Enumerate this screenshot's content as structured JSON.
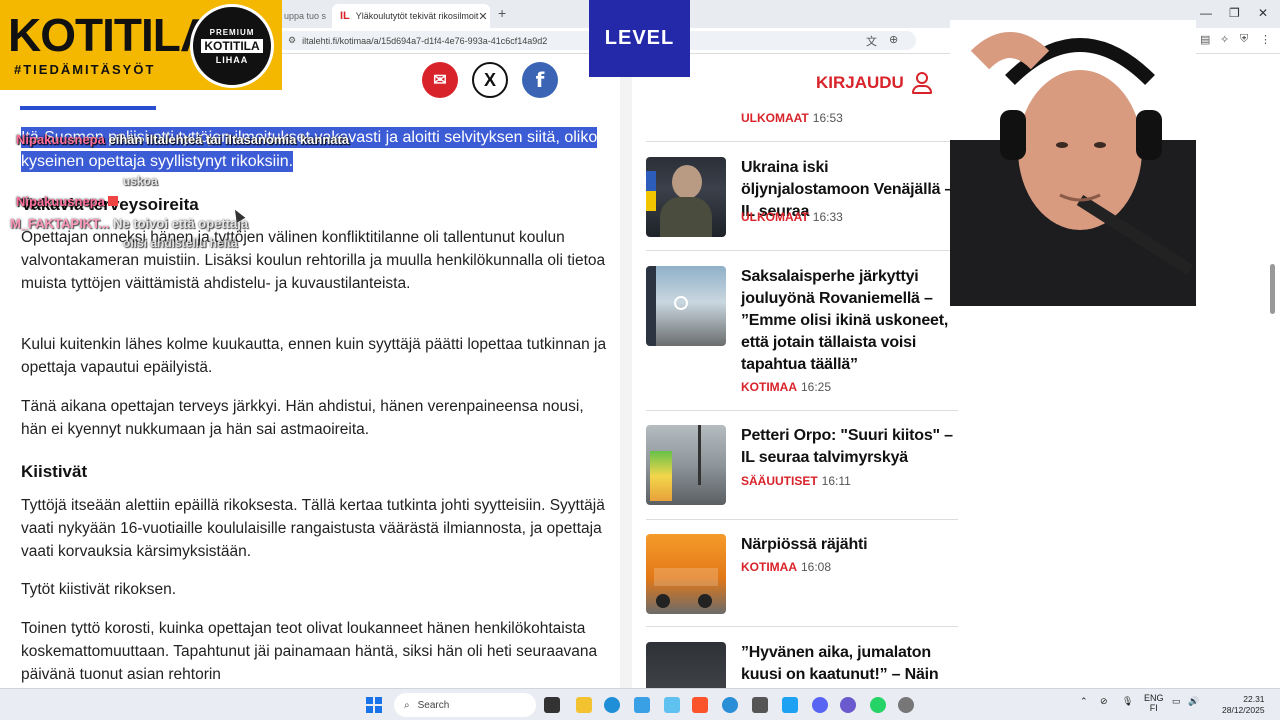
{
  "browser": {
    "inactive_tab": "uppa tuo s",
    "active_tab": "Yläkoulutytöt tekivät rikosilmoit",
    "url": "iltalehti.fi/kotimaa/a/15d694a7-d1f4-4e76-993a-41c6cf14a9d2"
  },
  "header": {
    "login_label": "KIRJAUDU"
  },
  "article": {
    "lead": "Itä-Suomen poliisi otti tyttöjen ilmoitukset vakavasti ja aloitti selvityksen siitä, oliko kyseinen opettaja syyllistynyt rikoksiin.",
    "heading1": "Vakavia terveysoireita",
    "p1": "Opettajan onneksi hänen ja tyttöjen välinen konfliktitilanne oli tallentunut koulun valvontakameran muistiin. Lisäksi koulun rehtorilla ja muulla henkilökunnalla oli tietoa muista tyttöjen väittämistä ahdistelu- ja kuvaustilanteista.",
    "p2": "Kului kuitenkin lähes kolme kuukautta, ennen kuin syyttäjä päätti lopettaa tutkinnan ja opettaja vapautui epäilyistä.",
    "p3": "Tänä aikana opettajan terveys järkkyi. Hän ahdistui, hänen verenpaineensa nousi, hän ei kyennyt nukkumaan ja hän sai astmaoireita.",
    "heading2": "Kiistivät",
    "p4": "Tyttöjä itseään alettiin epäillä rikoksesta. Tällä kertaa tutkinta johti syytteisiin. Syyttäjä vaati nykyään 16-vuotiaille koululaisille rangaistusta väärästä ilmiannosta, ja opettaja vaati korvauksia kärsimyksistään.",
    "p5": "Tytöt kiistivät rikoksen.",
    "p6": "Toinen tyttö korosti, kuinka opettajan teot olivat loukanneet hänen henkilökohtaista koskemattomuuttaan. Tapahtunut jäi painamaan häntä, siksi hän oli heti seuraavana päivänä tuonut asian rehtorin"
  },
  "news": [
    {
      "title": "",
      "category": "ULKOMAAT",
      "time": "16:53"
    },
    {
      "title": "Ukraina iski öljynjalostamoon Venäjällä – IL seuraa",
      "category": "ULKOMAAT",
      "time": "16:33"
    },
    {
      "title": "Saksalaisperhe järkyttyi jouluyönä Rovaniemellä – ”Emme olisi ikinä uskoneet, että jotain tällaista voisi tapahtua täällä”",
      "category": "KOTIMAA",
      "time": "16:25"
    },
    {
      "title": "Petteri Orpo: \"Suuri kiitos\" – IL seuraa talvimyrskyä",
      "category": "SÄÄUUTISET",
      "time": "16:11"
    },
    {
      "title": "Närpiössä räjähti",
      "category": "KOTIMAA",
      "time": "16:08"
    },
    {
      "title": "”Hyvänen aika, jumalaton kuusi on kaatunut!” – Näin",
      "category": "",
      "time": ""
    }
  ],
  "overlay": {
    "logo_main": "KOTITILA",
    "logo_tag": "#TIEDÄMITÄSYÖT",
    "seal_top": "PREMIUM",
    "seal_mid": "KOTITILA",
    "seal_bottom": "LIHAA",
    "level_label": "LEVEL"
  },
  "chat": [
    {
      "user": "Nipakuusnepa",
      "msg": "eihän iltalehteä tai iltasanomia kannata",
      "msg2": "uskoa"
    },
    {
      "user": "Nipakuusnepa",
      "msg": ""
    },
    {
      "user": "M_FAKTAPIKT...",
      "msg": "Ne toivoi että opettaja",
      "msg2": "olisi ahdistellu heitä"
    }
  ],
  "taskbar": {
    "search_placeholder": "Search",
    "lang1": "ENG",
    "lang2": "FI",
    "time": "22.31",
    "date": "28/12/2025"
  }
}
